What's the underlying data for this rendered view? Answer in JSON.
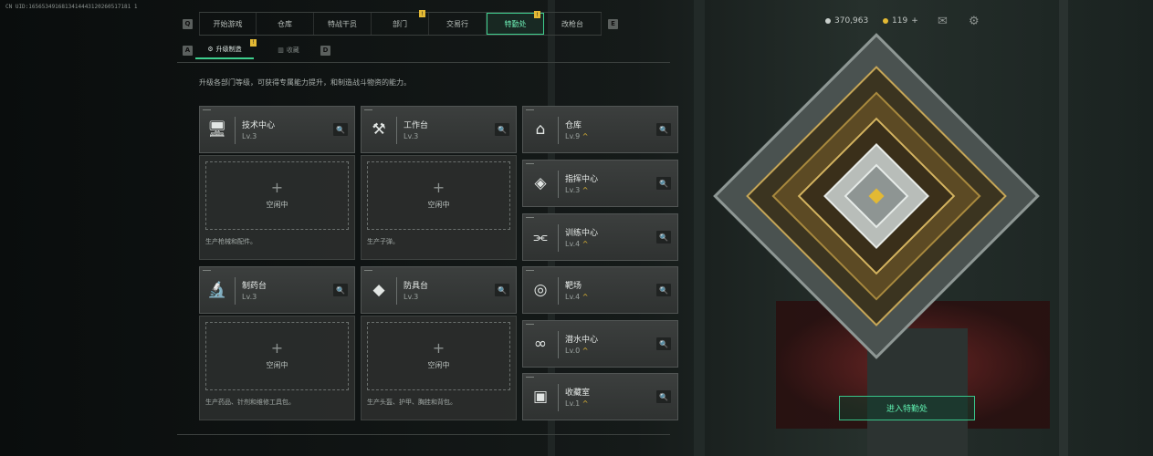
{
  "uid": "CN UID:1656534916813414443120260517181 1",
  "nav": {
    "tabs": [
      {
        "label": "开始游戏",
        "badge": ""
      },
      {
        "label": "仓库",
        "badge": ""
      },
      {
        "label": "特战干员",
        "badge": ""
      },
      {
        "label": "部门",
        "badge": "!"
      },
      {
        "label": "交易行",
        "badge": ""
      },
      {
        "label": "特勤处",
        "badge": "!"
      },
      {
        "label": "改枪台",
        "badge": ""
      }
    ],
    "prev_key": "Q",
    "next_key": "E",
    "active": "特勤处"
  },
  "resources": {
    "currency": "370,963",
    "currency_icon": "coin-icon",
    "coupon": "119",
    "coupon_add": "+"
  },
  "subnav": {
    "prev_key": "A",
    "next_key": "D",
    "tabs": [
      {
        "label": "升级制造",
        "badge": "!"
      },
      {
        "label": "收藏",
        "badge": ""
      }
    ]
  },
  "description": "升级各部门等级，可获得专属能力提升，和制造战斗物资的能力。",
  "production": [
    {
      "name": "技术中心",
      "level": "Lv.3",
      "icon": "monitor-icon",
      "slot_status": "空闲中",
      "note": "生产枪械和配件。"
    },
    {
      "name": "工作台",
      "level": "Lv.3",
      "icon": "tools-icon",
      "slot_status": "空闲中",
      "note": "生产子弹。"
    },
    {
      "name": "制药台",
      "level": "Lv.3",
      "icon": "microscope-icon",
      "slot_status": "空闲中",
      "note": "生产药品、针剂和维修工具包。"
    },
    {
      "name": "防具台",
      "level": "Lv.3",
      "icon": "armor-icon",
      "slot_status": "空闲中",
      "note": "生产头盔、护甲、胸挂和背包。"
    }
  ],
  "facilities": [
    {
      "name": "仓库",
      "level": "Lv.9",
      "icon": "warehouse-icon",
      "upgradable": "^"
    },
    {
      "name": "指挥中心",
      "level": "Lv.3",
      "icon": "command-icon",
      "upgradable": "^"
    },
    {
      "name": "训练中心",
      "level": "Lv.4",
      "icon": "dumbbell-icon",
      "upgradable": "^"
    },
    {
      "name": "靶场",
      "level": "Lv.4",
      "icon": "target-icon",
      "upgradable": "^"
    },
    {
      "name": "潜水中心",
      "level": "Lv.0",
      "icon": "diving-goggles-icon",
      "upgradable": "^"
    },
    {
      "name": "收藏室",
      "level": "Lv.1",
      "icon": "collection-icon",
      "upgradable": "^"
    }
  ],
  "enter_button": "进入特勤处"
}
